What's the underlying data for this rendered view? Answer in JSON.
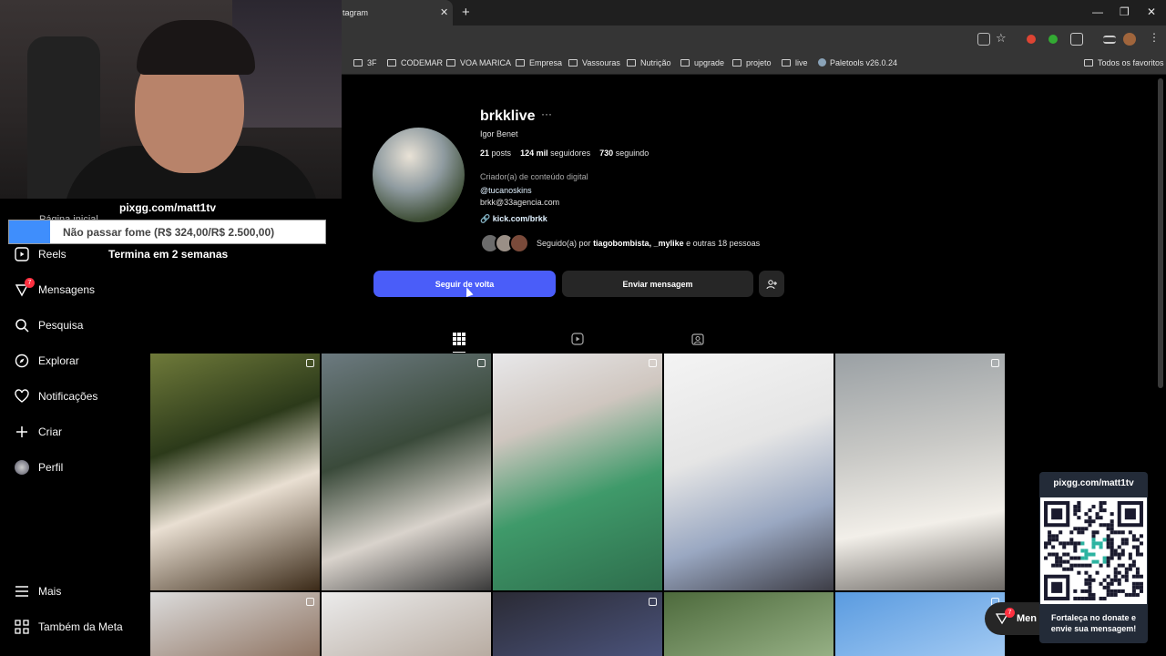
{
  "browser": {
    "tab_title": "tagram",
    "tab_close": "✕",
    "new_tab": "+",
    "minimize": "—",
    "restore": "❐",
    "close": "✕",
    "bookmarks": [
      "3F",
      "CODEMAR",
      "VOA MARICA",
      "Empresa",
      "Vassouras",
      "Nutrição",
      "upgrade",
      "projeto",
      "live",
      "Paletools v26.0.24"
    ],
    "all_bookmarks": "Todos os favoritos"
  },
  "overlay": {
    "pix_url": "pixgg.com/matt1tv",
    "goal_text": "Não passar fome (R$ 324,00/R$ 2.500,00)",
    "goal_progress": 0.13,
    "goal_sub": "Termina em 2 semanas",
    "qr_title": "pixgg.com/matt1tv",
    "qr_caption": "Fortaleça no donate e envie sua mensagem!"
  },
  "sidebar": {
    "items": [
      {
        "label": "Página inicial",
        "icon": "home-icon"
      },
      {
        "label": "Reels",
        "icon": "reels-icon"
      },
      {
        "label": "Mensagens",
        "icon": "messenger-icon",
        "badge": "7"
      },
      {
        "label": "Pesquisa",
        "icon": "search-icon"
      },
      {
        "label": "Explorar",
        "icon": "compass-icon"
      },
      {
        "label": "Notificações",
        "icon": "heart-icon"
      },
      {
        "label": "Criar",
        "icon": "plus-icon"
      },
      {
        "label": "Perfil",
        "icon": "profile-avatar-icon"
      }
    ],
    "more": "Mais",
    "meta": "Também da Meta"
  },
  "profile": {
    "username": "brkklive",
    "more": "···",
    "full_name": "Igor Benet",
    "posts_count": "21",
    "posts_label": "posts",
    "followers_count": "124 mil",
    "followers_label": "seguidores",
    "following_count": "730",
    "following_label": "seguindo",
    "category": "Criador(a) de conteúdo digital",
    "mention": "@tucanoskins",
    "email": "brkk@33agencia.com",
    "link": "kick.com/brkk",
    "followed_prefix": "Seguido(a) por",
    "followed_names": "tiagobombista, _mylike",
    "followed_suffix": "e outras 18 pessoas"
  },
  "actions": {
    "follow_back": "Seguir de volta",
    "send_message": "Enviar mensagem"
  },
  "messages_pill": {
    "label": "Men",
    "badge": "7"
  },
  "colors": {
    "primary_button": "#4a5df9",
    "secondary_button": "#262626",
    "background": "#000000",
    "badge": "#ff3040"
  }
}
